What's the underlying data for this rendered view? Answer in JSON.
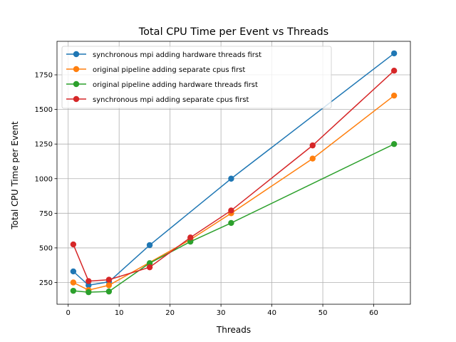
{
  "chart_data": {
    "type": "line",
    "title": "Total CPU Time per Event vs Threads",
    "xlabel": "Threads",
    "ylabel": "Total CPU Time per Event",
    "xlim": [
      -2.2,
      67.2
    ],
    "ylim": [
      93,
      1992
    ],
    "xticks": [
      0,
      10,
      20,
      30,
      40,
      50,
      60
    ],
    "yticks": [
      250,
      500,
      750,
      1000,
      1250,
      1500,
      1750
    ],
    "grid": true,
    "legend_position": "upper-left",
    "series": [
      {
        "name": "synchronous mpi adding hardware threads first",
        "color": "#1f77b4",
        "x": [
          1,
          4,
          8,
          16,
          32,
          64
        ],
        "y": [
          330,
          230,
          255,
          520,
          1000,
          1905
        ]
      },
      {
        "name": "original pipeline adding separate cpus first",
        "color": "#ff7f0e",
        "x": [
          1,
          4,
          8,
          24,
          32,
          48,
          64
        ],
        "y": [
          250,
          195,
          230,
          560,
          750,
          1145,
          1600
        ]
      },
      {
        "name": "original pipeline adding hardware threads first",
        "color": "#2ca02c",
        "x": [
          1,
          4,
          8,
          16,
          24,
          32,
          64
        ],
        "y": [
          190,
          180,
          185,
          390,
          545,
          680,
          1250
        ]
      },
      {
        "name": "synchronous mpi adding separate cpus first",
        "color": "#d62728",
        "x": [
          1,
          4,
          8,
          16,
          24,
          32,
          48,
          64
        ],
        "y": [
          525,
          260,
          270,
          360,
          575,
          770,
          1240,
          1780
        ]
      }
    ]
  }
}
